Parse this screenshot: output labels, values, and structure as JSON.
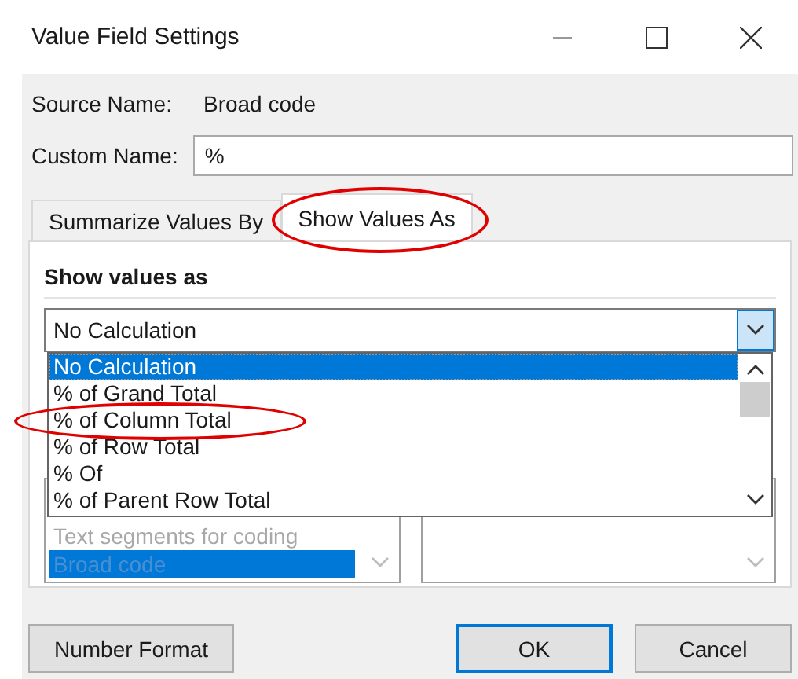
{
  "window": {
    "title": "Value Field Settings"
  },
  "source": {
    "label": "Source Name:",
    "value": "Broad code"
  },
  "custom_name": {
    "label": "Custom Name:",
    "value": "%"
  },
  "tabs": [
    {
      "label": "Summarize Values By",
      "selected": false,
      "circled": false
    },
    {
      "label": "Show Values As",
      "selected": true,
      "circled": true
    }
  ],
  "section_title": "Show values as",
  "combo": {
    "value": "No Calculation",
    "expanded": true
  },
  "dropdown_items": [
    {
      "label": "No Calculation",
      "selected": true,
      "circled": false
    },
    {
      "label": "% of Grand Total",
      "selected": false,
      "circled": false
    },
    {
      "label": "% of Column Total",
      "selected": false,
      "circled": true
    },
    {
      "label": "% of Row Total",
      "selected": false,
      "circled": false
    },
    {
      "label": "% Of",
      "selected": false,
      "circled": false
    },
    {
      "label": "% of Parent Row Total",
      "selected": false,
      "circled": false
    }
  ],
  "base_field": {
    "items": [
      {
        "label": "Text segments for coding",
        "selected": false
      },
      {
        "label": "Broad code",
        "selected": true
      }
    ]
  },
  "buttons": [
    {
      "label": "Number Format",
      "kind": "left",
      "default": false
    },
    {
      "label": "OK",
      "kind": "right",
      "default": true
    },
    {
      "label": "Cancel",
      "kind": "right",
      "default": false
    }
  ]
}
